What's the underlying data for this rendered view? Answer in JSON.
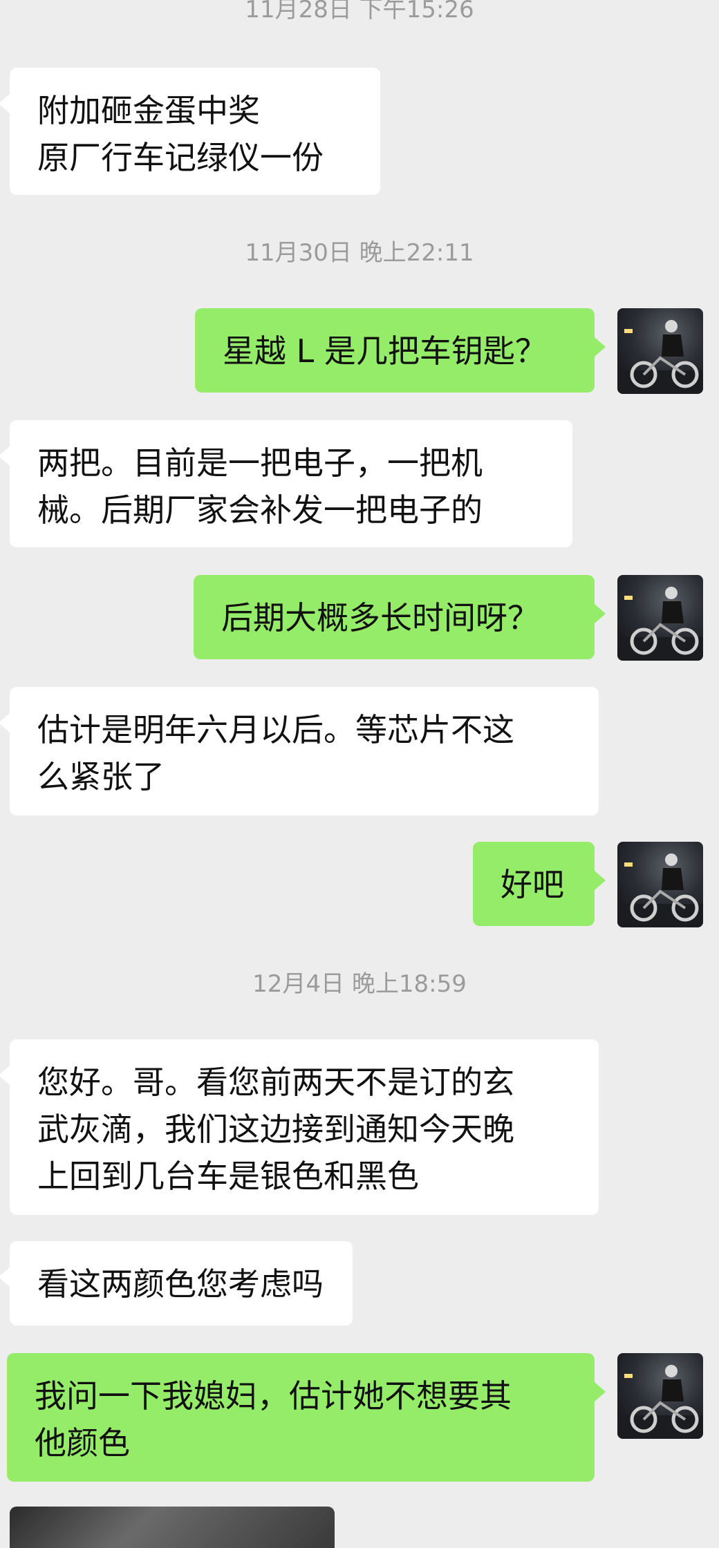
{
  "timestamps": [
    "11月28日 下午15:26",
    "11月30日 晚上22:11",
    "12月4日 晚上18:59"
  ],
  "messages": [
    {
      "side": "in",
      "text": "附加砸金蛋中奖\n原厂行车记绿仪一份"
    },
    {
      "side": "out",
      "text": "星越 L 是几把车钥匙？"
    },
    {
      "side": "in",
      "text": "两把。目前是一把电子，一把机\n械。后期厂家会补发一把电子的"
    },
    {
      "side": "out",
      "text": "后期大概多长时间呀？"
    },
    {
      "side": "in",
      "text": "估计是明年六月以后。等芯片不这\n么紧张了"
    },
    {
      "side": "out",
      "text": "好吧"
    },
    {
      "side": "in",
      "text": "您好。哥。看您前两天不是订的玄\n武灰滴，我们这边接到通知今天晚\n上回到几台车是银色和黑色"
    },
    {
      "side": "in",
      "text": "看这两颜色您考虑吗"
    },
    {
      "side": "out",
      "text": "我问一下我媳妇，估计她不想要其\n他颜色"
    }
  ],
  "colors": {
    "background": "#ededed",
    "incoming_bubble": "#ffffff",
    "outgoing_bubble": "#95ec69",
    "timestamp_text": "#9b9b9b"
  },
  "icons": {
    "avatar": "user-avatar-motorcycle-rider",
    "image_message": "image-thumbnail"
  }
}
